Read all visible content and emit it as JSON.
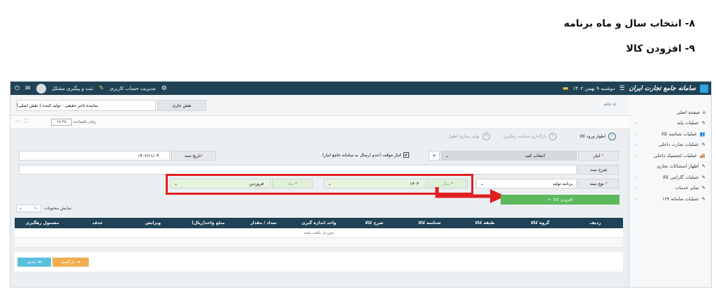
{
  "doc": {
    "heading_8": "۸- انتخاب سال و ماه برنامه",
    "heading_9": "۹- افزودن کالا"
  },
  "topbar": {
    "logo_text": "سامانه جامع تجارت ایران",
    "date": "دوشنبه ۹ بهمن ۱۴۰۲",
    "account_mgmt": "مدیریت حساب کاربری",
    "issue_tracking": "ثبت و پیگیری مشکل"
  },
  "sidebar": {
    "items": [
      {
        "label": "صفحه اصلی",
        "icon": "home-icon",
        "chevron": false
      },
      {
        "label": "عملیات پایه",
        "icon": "edit-icon",
        "chevron": true
      },
      {
        "label": "عملیات شناسه کالا",
        "icon": "users-icon",
        "chevron": true
      },
      {
        "label": "عملیات تجارت داخلی",
        "icon": "edit-icon",
        "chevron": true
      },
      {
        "label": "عملیات لجستیک داخلی",
        "icon": "truck-icon",
        "chevron": true
      },
      {
        "label": "اظهار استثنائات تجاری",
        "icon": "edit-icon",
        "chevron": false
      },
      {
        "label": "عملیات گارانتی کالا",
        "icon": "edit-icon",
        "chevron": true
      },
      {
        "label": "سایر خدمات",
        "icon": "edit-icon",
        "chevron": true
      },
      {
        "label": "عملیات سامانه ۱۲۴",
        "icon": "edit-icon",
        "chevron": true
      }
    ]
  },
  "header": {
    "breadcrumb": "خانه",
    "current_role_label": "نقش جاری",
    "current_role_value": "نماینده تاجر حقیقی - تولید کننده ( نقش اصلی)",
    "remaining_time_label": "زمان باقیمانده",
    "remaining_time_value": "۲۸:۳۵"
  },
  "steps": [
    {
      "num": "۱",
      "label": "اظهار ورود کالا",
      "active": true
    },
    {
      "num": "۲",
      "label": "بارگذاری شناسه رهگیری",
      "active": false
    },
    {
      "num": "۳",
      "label": "نهایی سازی اظهار",
      "active": false
    }
  ],
  "form": {
    "warehouse_label": "انبار",
    "warehouse_placeholder": "انتخاب کنید",
    "temp_warehouse_label": "انبار موقت (عدم ارسال به سامانه جامع انبار)",
    "doc_date_label": "تاریخ سند",
    "doc_date_value": "۱۴۰۲/۱۱/۰۹",
    "doc_desc_label": "شرح سند",
    "doc_type_label": "نوع سند",
    "doc_type_value": "برنامه تولید",
    "year_label": "سال",
    "year_value": "۱۴۰۳",
    "month_label": "ماه",
    "month_value": "فروردین",
    "add_goods_button": "افزودن کالا"
  },
  "table": {
    "page_size_label": "نمایش محتویات",
    "page_size_value": "۱۰",
    "columns": [
      "ردیف",
      "گروه کالا",
      "طبقه کالا",
      "شناسه کالا",
      "شرح کالا",
      "واحد اندازه گیری",
      "تعداد / مقدار",
      "مبلغ واحد(ریال)",
      "ویرایش",
      "حذف",
      "مشمول رهگیری"
    ],
    "empty_text": "موردی یافت نشد"
  },
  "footer": {
    "back_button": "بازگشت",
    "next_button": "بعدی"
  },
  "colors": {
    "topbar": "#1f4256",
    "highlight": "#e02020",
    "add_button": "#5cb85c",
    "next_button": "#5bc0de",
    "back_button": "#f0ad4e"
  }
}
